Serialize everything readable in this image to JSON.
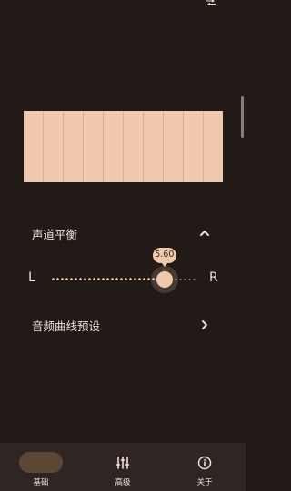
{
  "icons": {
    "status": "swap-icon",
    "balance_toggle": "chevron-up-icon",
    "presets_arrow": "chevron-right-icon",
    "nav_advanced": "tune-sliders-icon",
    "nav_about": "info-icon"
  },
  "colors": {
    "background": "#211a17",
    "accent": "#f0c9ac",
    "nav_background": "#2f2623",
    "nav_active_pill": "#5c4636"
  },
  "equalizer": {
    "band_count": 10
  },
  "balance": {
    "title": "声道平衡",
    "left_label": "L",
    "right_label": "R",
    "value_label": "5.60",
    "value": 5.6,
    "min": -10,
    "max": 10
  },
  "presets": {
    "title": "音频曲线预设"
  },
  "nav": {
    "items": [
      {
        "label": "基础",
        "active": true
      },
      {
        "label": "高级",
        "active": false
      },
      {
        "label": "关于",
        "active": false
      }
    ]
  }
}
